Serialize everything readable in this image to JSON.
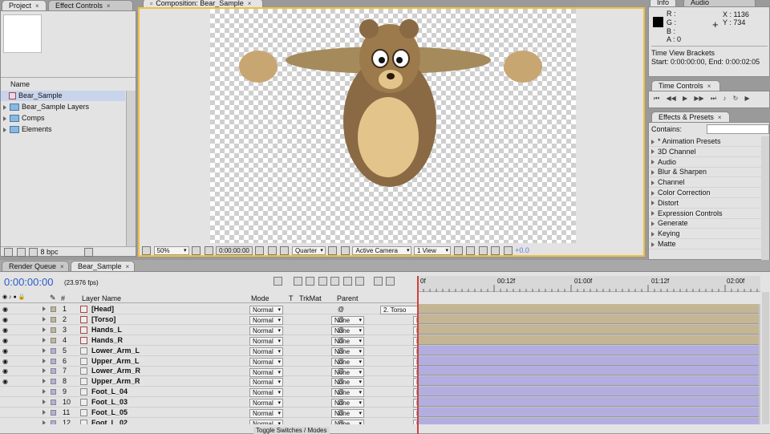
{
  "project_panel": {
    "tabs": [
      "Project",
      "Effect Controls"
    ],
    "column_name": "Name",
    "items": [
      {
        "name": "Bear_Sample",
        "type": "comp"
      },
      {
        "name": "Bear_Sample Layers",
        "type": "folder"
      },
      {
        "name": "Comps",
        "type": "folder"
      },
      {
        "name": "Elements",
        "type": "folder"
      }
    ],
    "bpc": "8 bpc"
  },
  "composition": {
    "tab": "Composition: Bear_Sample",
    "zoom": "50%",
    "timecode": "0:00:00:00",
    "resolution": "Quarter",
    "camera": "Active Camera",
    "views": "1 View",
    "exposure": "+0.0"
  },
  "info_panel": {
    "tabs": [
      "Info",
      "Audio"
    ],
    "r": "R :",
    "g": "G :",
    "b": "B :",
    "a": "A : 0",
    "x": "X : 1136",
    "y": "Y : 734",
    "line1": "Time View Brackets",
    "line2": "Start: 0:00:00:00, End: 0:00:02:05"
  },
  "time_controls": {
    "tab": "Time Controls"
  },
  "effects_presets": {
    "tab": "Effects & Presets",
    "contains_label": "Contains:",
    "items": [
      "* Animation Presets",
      "3D Channel",
      "Audio",
      "Blur & Sharpen",
      "Channel",
      "Color Correction",
      "Distort",
      "Expression Controls",
      "Generate",
      "Keying",
      "Matte"
    ]
  },
  "timeline": {
    "tabs": [
      "Render Queue",
      "Bear_Sample"
    ],
    "timecode": "0:00:00:00",
    "fps": "(23.976 fps)",
    "headers": {
      "num": "#",
      "layer_name": "Layer Name",
      "mode": "Mode",
      "t": "T",
      "trkmat": "TrkMat",
      "parent": "Parent"
    },
    "ruler": [
      "0f",
      "00:12f",
      "01:00f",
      "01:12f",
      "02:00f"
    ],
    "toggle_label": "Toggle Switches / Modes",
    "layers": [
      {
        "num": "1",
        "name": "[Head]",
        "mode": "Normal",
        "trkmat": "",
        "parent": "2. Torso",
        "color": "#c4b594"
      },
      {
        "num": "2",
        "name": "[Torso]",
        "mode": "Normal",
        "trkmat": "None",
        "parent": "None",
        "color": "#c4b594"
      },
      {
        "num": "3",
        "name": "Hands_L",
        "mode": "Normal",
        "trkmat": "None",
        "parent": "None",
        "color": "#c4b594"
      },
      {
        "num": "4",
        "name": "Hands_R",
        "mode": "Normal",
        "trkmat": "None",
        "parent": "None",
        "color": "#c4b594"
      },
      {
        "num": "5",
        "name": "Lower_Arm_L",
        "mode": "Normal",
        "trkmat": "None",
        "parent": "None",
        "color": "#b3aee0"
      },
      {
        "num": "6",
        "name": "Upper_Arm_L",
        "mode": "Normal",
        "trkmat": "None",
        "parent": "None",
        "color": "#b3aee0"
      },
      {
        "num": "7",
        "name": "Lower_Arm_R",
        "mode": "Normal",
        "trkmat": "None",
        "parent": "None",
        "color": "#b3aee0"
      },
      {
        "num": "8",
        "name": "Upper_Arm_R",
        "mode": "Normal",
        "trkmat": "None",
        "parent": "None",
        "color": "#b3aee0"
      },
      {
        "num": "9",
        "name": "Foot_L_04",
        "mode": "Normal",
        "trkmat": "None",
        "parent": "None",
        "color": "#b3aee0"
      },
      {
        "num": "10",
        "name": "Foot_L_03",
        "mode": "Normal",
        "trkmat": "None",
        "parent": "None",
        "color": "#b3aee0"
      },
      {
        "num": "11",
        "name": "Foot_L_05",
        "mode": "Normal",
        "trkmat": "None",
        "parent": "None",
        "color": "#b3aee0"
      },
      {
        "num": "12",
        "name": "Foot_L_02",
        "mode": "Normal",
        "trkmat": "None",
        "parent": "None",
        "color": "#b3aee0"
      }
    ]
  },
  "colors": {
    "accent": "#f0c040",
    "panel": "#e3e3e3",
    "timecode": "#2a5ac8"
  }
}
